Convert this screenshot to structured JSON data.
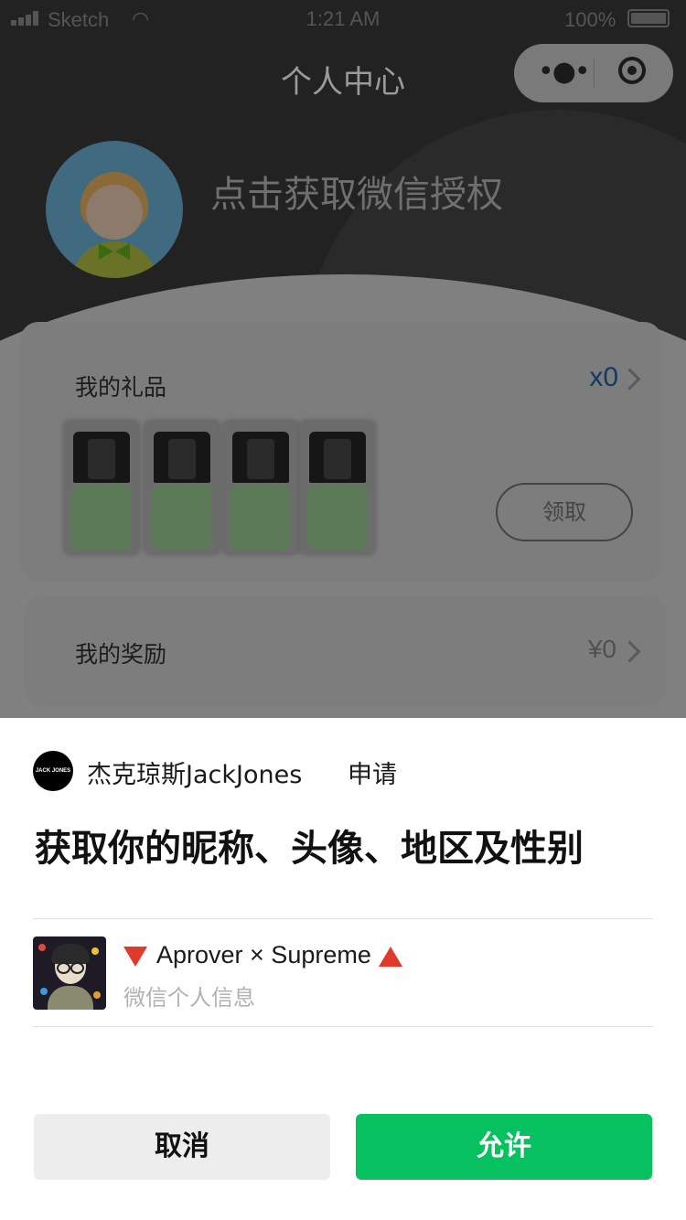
{
  "status_bar": {
    "carrier": "Sketch",
    "time": "1:21 AM",
    "battery": "100%"
  },
  "nav": {
    "title": "个人中心"
  },
  "profile": {
    "auth_prompt": "点击获取微信授权"
  },
  "gifts_card": {
    "title": "我的礼品",
    "count": "x0",
    "claim_label": "领取"
  },
  "rewards_card": {
    "title": "我的奖励",
    "amount": "¥0"
  },
  "auth_sheet": {
    "app_logo_text": "JACK JONES",
    "app_name": "杰克琼斯JackJones",
    "apply_label": "申请",
    "title": "获取你的昵称、头像、地区及性别",
    "user_name": "Aprover × Supreme",
    "user_subtitle": "微信个人信息",
    "cancel_label": "取消",
    "allow_label": "允许"
  },
  "colors": {
    "allow_green": "#07c160",
    "cancel_gray": "#ededed",
    "emoji_red": "#e03a2a"
  },
  "icons": [
    "signal-icon",
    "wifi-icon",
    "battery-icon",
    "more-icon",
    "close-circle-icon",
    "chevron-right-icon",
    "triangle-down-icon",
    "triangle-up-icon"
  ]
}
